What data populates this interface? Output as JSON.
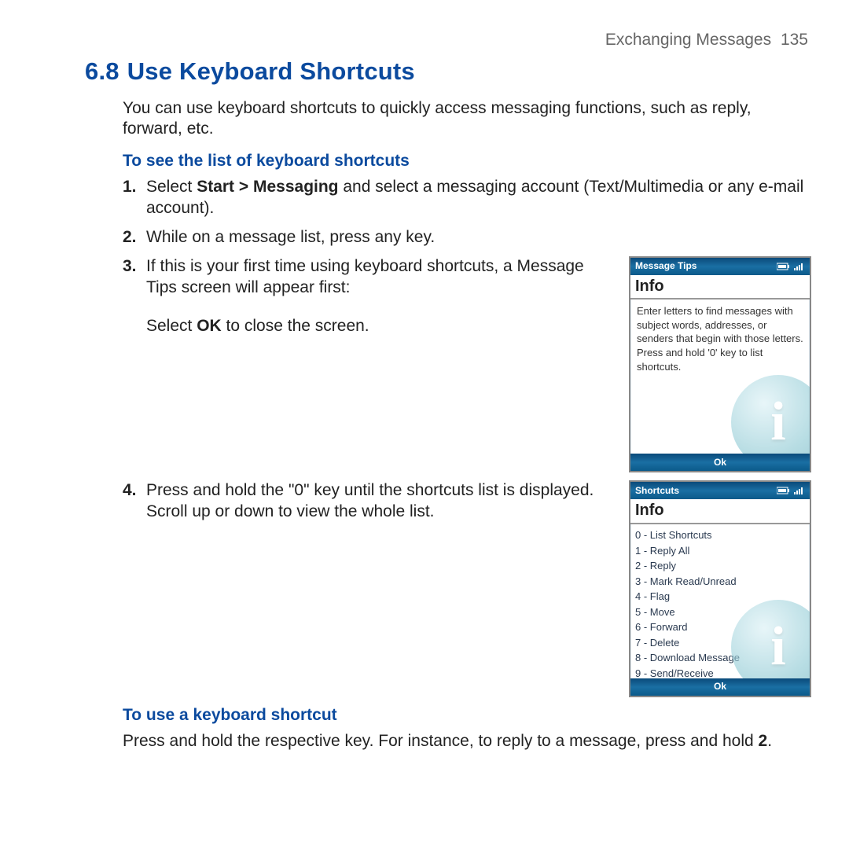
{
  "header": {
    "chapter": "Exchanging Messages",
    "page": "135"
  },
  "section": {
    "number": "6.8",
    "title": "Use Keyboard Shortcuts"
  },
  "intro": "You can use keyboard shortcuts to quickly access messaging functions, such as reply, forward, etc.",
  "sub1": "To see the list of keyboard shortcuts",
  "steps": {
    "s1_a": "Select ",
    "s1_b": "Start > Messaging",
    "s1_c": " and select a messaging account (Text/Multimedia or any e-mail account).",
    "s2": "While on a message list, press any key.",
    "s3": "If this is your first time using keyboard shortcuts, a Message Tips screen will appear first:",
    "s3_extra_a": "Select ",
    "s3_extra_b": "OK",
    "s3_extra_c": " to close the screen.",
    "s4": "Press and hold the \"0\" key until the shortcuts list is displayed. Scroll up or down to view the whole list."
  },
  "sub2": "To use a keyboard shortcut",
  "use_para_a": "Press and hold the respective key. For instance, to reply to a message, press and hold ",
  "use_para_b": "2",
  "use_para_c": ".",
  "phone1": {
    "title": "Message Tips",
    "heading": "Info",
    "body": "Enter letters to find messages with subject words, addresses, or senders that begin with those letters.  Press and hold '0' key to list shortcuts.",
    "ok": "Ok"
  },
  "phone2": {
    "title": "Shortcuts",
    "heading": "Info",
    "items": [
      "0 - List Shortcuts",
      "1 - Reply All",
      "2 - Reply",
      "3 - Mark Read/Unread",
      "4 - Flag",
      "5 - Move",
      "6 - Forward",
      "7 - Delete",
      "8 - Download Message",
      "9 - Send/Receive"
    ],
    "ok": "Ok"
  }
}
